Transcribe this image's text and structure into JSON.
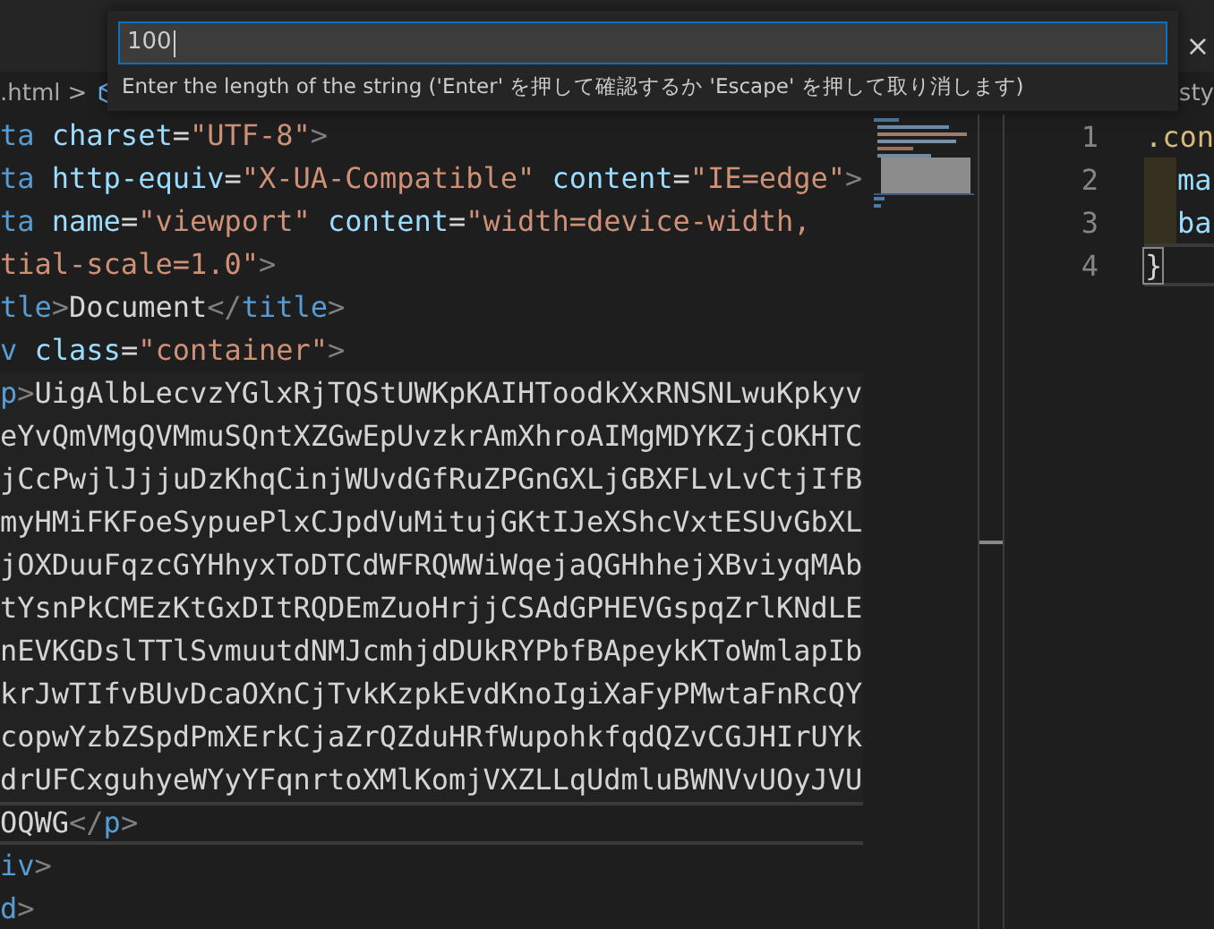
{
  "quick_input": {
    "value": "100",
    "hint": "Enter the length of the string ('Enter' を押して確認するか 'Escape' を押して取り消します)"
  },
  "close_button": "×",
  "breadcrumb": {
    "file": ".html",
    "separator": ">"
  },
  "right_tab": "sty",
  "editor": {
    "lines": [
      {
        "current": false,
        "segments": [
          {
            "kind": "tag",
            "text": "ta"
          },
          {
            "kind": "attr",
            "text": " charset"
          },
          {
            "kind": "text",
            "text": "="
          },
          {
            "kind": "str",
            "text": "\"UTF-8\""
          },
          {
            "kind": "punct",
            "text": ">"
          }
        ]
      },
      {
        "current": false,
        "segments": [
          {
            "kind": "tag",
            "text": "ta"
          },
          {
            "kind": "attr",
            "text": " http-equiv"
          },
          {
            "kind": "text",
            "text": "="
          },
          {
            "kind": "str",
            "text": "\"X-UA-Compatible\""
          },
          {
            "kind": "attr",
            "text": " content"
          },
          {
            "kind": "text",
            "text": "="
          },
          {
            "kind": "str",
            "text": "\"IE=edge\""
          },
          {
            "kind": "punct",
            "text": ">"
          }
        ]
      },
      {
        "current": false,
        "segments": [
          {
            "kind": "tag",
            "text": "ta"
          },
          {
            "kind": "attr",
            "text": " name"
          },
          {
            "kind": "text",
            "text": "="
          },
          {
            "kind": "str",
            "text": "\"viewport\""
          },
          {
            "kind": "attr",
            "text": " content"
          },
          {
            "kind": "text",
            "text": "="
          },
          {
            "kind": "str",
            "text": "\"width=device-width,"
          }
        ]
      },
      {
        "current": false,
        "segments": [
          {
            "kind": "str",
            "text": "tial-scale=1.0\""
          },
          {
            "kind": "punct",
            "text": ">"
          }
        ]
      },
      {
        "current": false,
        "segments": [
          {
            "kind": "tag",
            "text": "tle"
          },
          {
            "kind": "punct",
            "text": ">"
          },
          {
            "kind": "text",
            "text": "Document"
          },
          {
            "kind": "punct",
            "text": "</"
          },
          {
            "kind": "tag",
            "text": "title"
          },
          {
            "kind": "punct",
            "text": ">"
          }
        ]
      },
      {
        "current": false,
        "segments": [
          {
            "kind": "tag",
            "text": "v"
          },
          {
            "kind": "attr",
            "text": " class"
          },
          {
            "kind": "text",
            "text": "="
          },
          {
            "kind": "str",
            "text": "\"container\""
          },
          {
            "kind": "punct",
            "text": ">"
          }
        ]
      },
      {
        "current": false,
        "segments": [
          {
            "kind": "tag",
            "text": "p"
          },
          {
            "kind": "punct",
            "text": ">"
          },
          {
            "kind": "text",
            "text": "UigAlbLecvzYGlxRjTQStUWKpKAIHToodkXxRNSNLwuKpkyv"
          }
        ]
      },
      {
        "current": false,
        "segments": [
          {
            "kind": "text",
            "text": "eYvQmVMgQVMmuSQntXZGwEpUvzkrAmXhroAIMgMDYKZjcOKHTC"
          }
        ]
      },
      {
        "current": false,
        "segments": [
          {
            "kind": "text",
            "text": "jCcPwjlJjjuDzKhqCinjWUvdGfRuZPGnGXLjGBXFLvLvCtjIfB"
          }
        ]
      },
      {
        "current": false,
        "segments": [
          {
            "kind": "text",
            "text": "myHMiFKFoeSypuePlxCJpdVuMitujGKtIJeXShcVxtESUvGbXL"
          }
        ]
      },
      {
        "current": false,
        "segments": [
          {
            "kind": "text",
            "text": "jOXDuuFqzcGYHhyxToDTCdWFRQWWiWqejaQGHhhejXBviyqMAb"
          }
        ]
      },
      {
        "current": false,
        "segments": [
          {
            "kind": "text",
            "text": "tYsnPkCMEzKtGxDItRQDEmZuoHrjjCSAdGPHEVGspqZrlKNdLE"
          }
        ]
      },
      {
        "current": false,
        "segments": [
          {
            "kind": "text",
            "text": "nEVKGDslTTlSvmuutdNMJcmhjdDUkRYPbfBApeykKToWmlapIb"
          }
        ]
      },
      {
        "current": false,
        "segments": [
          {
            "kind": "text",
            "text": "krJwTIfvBUvDcaOXnCjTvkKzpkEvdKnoIgiXaFyPMwtaFnRcQY"
          }
        ]
      },
      {
        "current": false,
        "segments": [
          {
            "kind": "text",
            "text": "copwYzbZSpdPmXErkCjaZrQZduHRfWupohkfqdQZvCGJHIrUYk"
          }
        ]
      },
      {
        "current": false,
        "segments": [
          {
            "kind": "text",
            "text": "drUFCxguhyeWYyYFqnrtoXMlKomjVXZLLqUdmluBWNVvUOyJVU"
          }
        ]
      },
      {
        "current": true,
        "segments": [
          {
            "kind": "text",
            "text": "OQWG"
          },
          {
            "kind": "punct",
            "text": "</"
          },
          {
            "kind": "tag",
            "text": "p"
          },
          {
            "kind": "punct",
            "text": ">"
          }
        ]
      },
      {
        "current": false,
        "segments": [
          {
            "kind": "tag",
            "text": "iv"
          },
          {
            "kind": "punct",
            "text": ">"
          }
        ]
      },
      {
        "current": false,
        "segments": [
          {
            "kind": "tag",
            "text": "d"
          },
          {
            "kind": "punct",
            "text": ">"
          }
        ]
      }
    ]
  },
  "css_editor": {
    "lines": [
      {
        "number": "1",
        "current": false,
        "segments": [
          {
            "kind": "selector",
            "text": ".con"
          }
        ]
      },
      {
        "number": "2",
        "current": false,
        "segments": [
          {
            "kind": "indent"
          },
          {
            "kind": "attr",
            "text": "ma"
          }
        ]
      },
      {
        "number": "3",
        "current": false,
        "segments": [
          {
            "kind": "indent"
          },
          {
            "kind": "attr",
            "text": "ba"
          }
        ]
      },
      {
        "number": "4",
        "current": true,
        "segments": [
          {
            "kind": "bracket",
            "text": "}"
          }
        ]
      }
    ]
  }
}
